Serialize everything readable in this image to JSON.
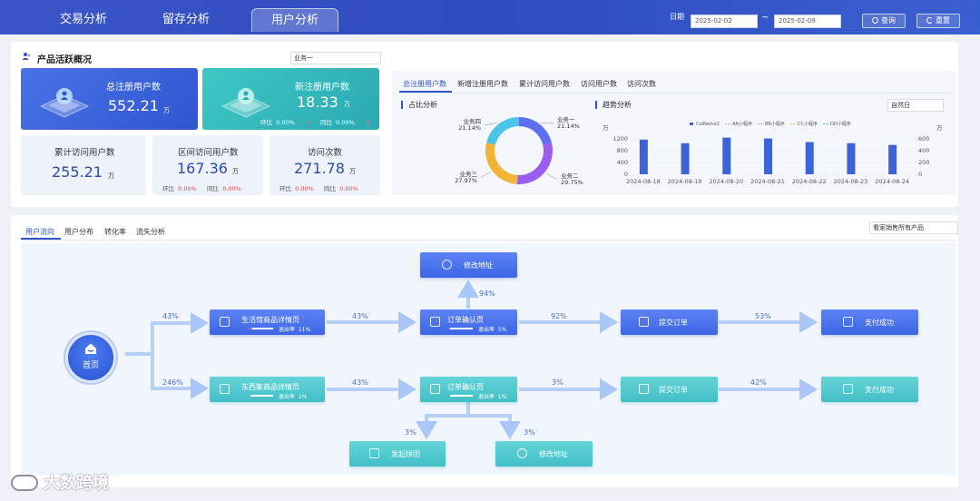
{
  "nav": {
    "tabs": [
      {
        "label": "交易分析"
      },
      {
        "label": "留存分析"
      },
      {
        "label": "用户分析"
      }
    ],
    "date_label": "日期",
    "date_from": "2025-02-02",
    "date_sep": "~",
    "date_to": "2025-02-09",
    "query_label": "查询",
    "reset_label": "重置"
  },
  "overview": {
    "title": "产品活跃概况",
    "business_select": "业务一",
    "total_users": {
      "label": "总注册用户数",
      "value": "552.21",
      "unit": "万"
    },
    "new_users": {
      "label": "新注册用户数",
      "value": "18.33",
      "unit": "万",
      "hb_label": "环比",
      "hb_value": "0.00%",
      "tb_label": "同比",
      "tb_value": "0.00%"
    },
    "cum_visit": {
      "label": "累计访问用户数",
      "value": "255.21",
      "unit": "万"
    },
    "range_visit": {
      "label": "区间访问用户数",
      "value": "167.36",
      "unit": "万",
      "hb_label": "环比",
      "hb_value": "0.00%",
      "tb_label": "同比",
      "tb_value": "0.00%"
    },
    "visits": {
      "label": "访问次数",
      "value": "271.78",
      "unit": "万",
      "hb_label": "环比",
      "hb_value": "0.00%",
      "tb_label": "同比",
      "tb_value": "0.00%"
    }
  },
  "right_panel": {
    "tabs": [
      "总注册用户数",
      "新增注册用户数",
      "累计访问用户数",
      "访问用户数",
      "访问次数"
    ],
    "ratio_title": "占比分析",
    "trend_title": "趋势分析",
    "period_select": "自然日"
  },
  "chart_data": [
    {
      "type": "pie",
      "labels": [
        "业务一",
        "业务二",
        "业务三",
        "业务四"
      ],
      "values": [
        21.14,
        29.75,
        27.97,
        21.14
      ],
      "display": [
        "21.14%",
        "29.75%",
        "27.97%",
        "21.14%"
      ],
      "colors": [
        "#5b6ff0",
        "#9b5cf0",
        "#f0b437",
        "#4ac5e8"
      ]
    },
    {
      "type": "bar",
      "categories": [
        "2024-08-18",
        "2024-08-19",
        "2024-08-20",
        "2024-08-21",
        "2024-08-22",
        "2024-08-23",
        "2024-08-24"
      ],
      "series": [
        {
          "name": "ColName2",
          "values": [
            1180,
            1060,
            1250,
            1220,
            1100,
            1060,
            1000
          ]
        },
        {
          "name": "AA小程序",
          "values": [
            null,
            null,
            null,
            null,
            null,
            null,
            null
          ]
        },
        {
          "name": "BB小程序",
          "values": [
            null,
            null,
            null,
            null,
            null,
            null,
            null
          ]
        },
        {
          "name": "CC小程序",
          "values": [
            null,
            null,
            null,
            null,
            null,
            null,
            null
          ]
        },
        {
          "name": "DD小程序",
          "values": [
            null,
            null,
            null,
            null,
            null,
            null,
            null
          ]
        }
      ],
      "ylabel_left": "万",
      "ylabel_right": "万",
      "yticks_left": [
        "1200",
        "800",
        "400",
        "0"
      ],
      "yticks_right": [
        "600",
        "400",
        "200",
        "0"
      ],
      "ylim_left": [
        0,
        1300
      ],
      "ylim_right": [
        0,
        650
      ],
      "bar_color": "#3e62d8"
    }
  ],
  "lower": {
    "tabs": [
      "用户流向",
      "用户分布",
      "转化率",
      "流失分析"
    ],
    "product_select": "看家销售所有产品",
    "home_label": "首页",
    "nodes": {
      "a1": {
        "label": "生活馆商品详情页",
        "rate_label": "退出率",
        "rate": "11%"
      },
      "a2": {
        "label": "订单确认页",
        "rate_label": "退出率",
        "rate": "5%"
      },
      "a3": {
        "label": "提交订单"
      },
      "a4": {
        "label": "支付成功"
      },
      "top": {
        "label": "修改地址"
      },
      "b1": {
        "label": "东西集商品详情页",
        "rate_label": "退出率",
        "rate": "1%"
      },
      "b2": {
        "label": "订单确认页",
        "rate_label": "退出率",
        "rate": "1%"
      },
      "b3": {
        "label": "提交订单"
      },
      "b4": {
        "label": "支付成功"
      },
      "c1": {
        "label": "发起拼团"
      },
      "c2": {
        "label": "修改地址"
      }
    },
    "pcts": {
      "home_a": "43%",
      "home_b": "246%",
      "a1_a2": "43%",
      "a2_top": "94%",
      "a2_a3": "92%",
      "a3_a4": "53%",
      "b1_b2": "43%",
      "b2_b3": "3%",
      "b3_b4": "42%",
      "b2_c1": "3%",
      "b2_c2": "3%"
    }
  },
  "watermark": "大数跨境"
}
